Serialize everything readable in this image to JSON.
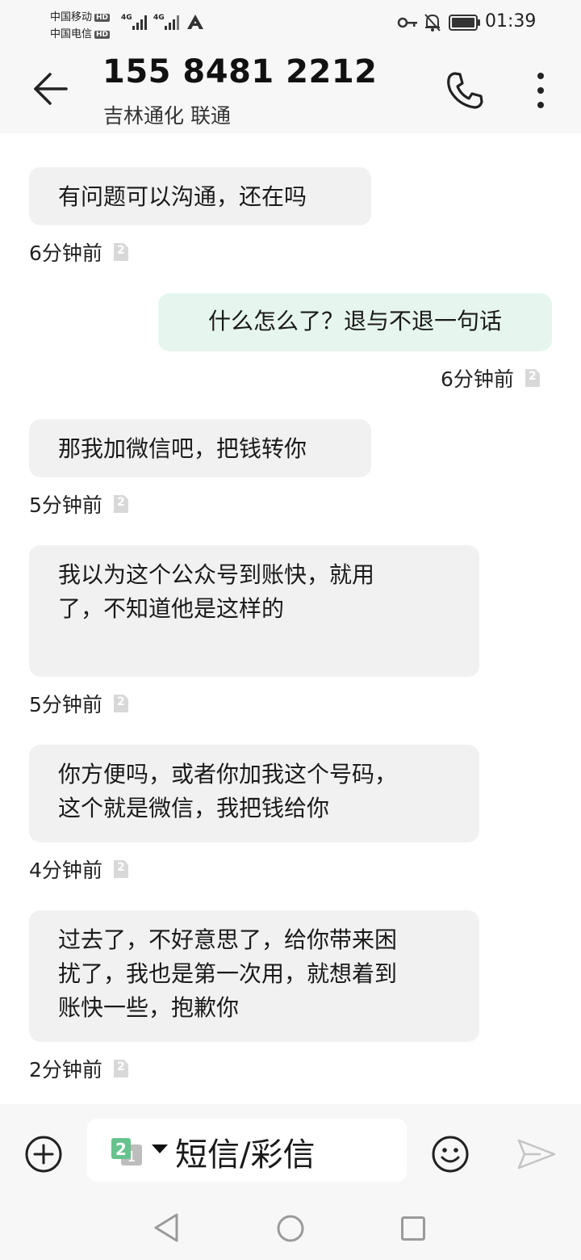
{
  "status_bar": {
    "carrier1": "中国移动",
    "carrier2": "中国电信",
    "hd_label": "HD",
    "net_type": "4G",
    "time": "01:39",
    "icons": [
      "signal-icon",
      "key-icon",
      "mute-icon",
      "battery-icon"
    ]
  },
  "header": {
    "title": "155 8481 2212",
    "subtitle": "吉林通化 联通",
    "icons": [
      "back-arrow-icon",
      "phone-icon",
      "more-vertical-icon"
    ]
  },
  "messages": [
    {
      "direction": "received",
      "lines": [
        "有问题可以沟通，还在吗"
      ],
      "time": "6分钟前",
      "sim": "2"
    },
    {
      "direction": "sent",
      "lines": [
        "什么怎么了？退与不退一句话"
      ],
      "time": "6分钟前",
      "sim": "2"
    },
    {
      "direction": "received",
      "lines": [
        "那我加微信吧，把钱转你"
      ],
      "time": "5分钟前",
      "sim": "2"
    },
    {
      "direction": "received",
      "lines": [
        "我以为这个公众号到账快，就用",
        "了，不知道他是这样的"
      ],
      "time": "5分钟前",
      "sim": "2"
    },
    {
      "direction": "received",
      "lines": [
        "你方便吗，或者你加我这个号码，",
        "这个就是微信，我把钱给你"
      ],
      "time": "4分钟前",
      "sim": "2"
    },
    {
      "direction": "received",
      "lines": [
        "过去了，不好意思了，给你带来困",
        "扰了，我也是第一次用，就想着到",
        "账快一些，抱歉你"
      ],
      "time": "2分钟前",
      "sim": "2"
    }
  ],
  "composer": {
    "placeholder": "短信/彩信",
    "sim_label": "2",
    "sim_sub": "1",
    "icons": [
      "add-circle-icon",
      "sim-select-icon",
      "emoji-icon",
      "send-icon"
    ]
  },
  "nav": {
    "icons": [
      "nav-back-icon",
      "nav-home-icon",
      "nav-recent-icon"
    ]
  }
}
